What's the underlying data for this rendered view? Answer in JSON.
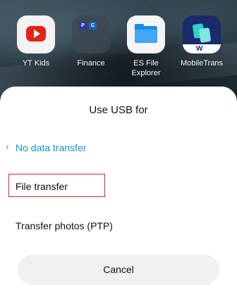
{
  "home_screen": {
    "apps": [
      {
        "label": "YT Kids",
        "icon": "youtube-kids-icon"
      },
      {
        "label": "Finance",
        "icon": "finance-folder-icon"
      },
      {
        "label": "ES File\nExplorer",
        "label_line1": "ES File",
        "label_line2": "Explorer",
        "icon": "es-file-explorer-icon"
      },
      {
        "label": "MobileTrans",
        "icon": "mobiletrans-icon"
      }
    ]
  },
  "dialog": {
    "title": "Use USB for",
    "options": [
      {
        "label": "No data transfer",
        "selected": true
      },
      {
        "label": "File transfer",
        "selected": false,
        "highlighted": true
      },
      {
        "label": "Transfer photos (PTP)",
        "selected": false
      }
    ],
    "cancel_label": "Cancel",
    "chevron": "›"
  },
  "colors": {
    "accent": "#1a8fd4",
    "highlight_border": "#d9262b",
    "sheet_bg": "#ffffff",
    "button_bg": "#f0f0f0"
  }
}
